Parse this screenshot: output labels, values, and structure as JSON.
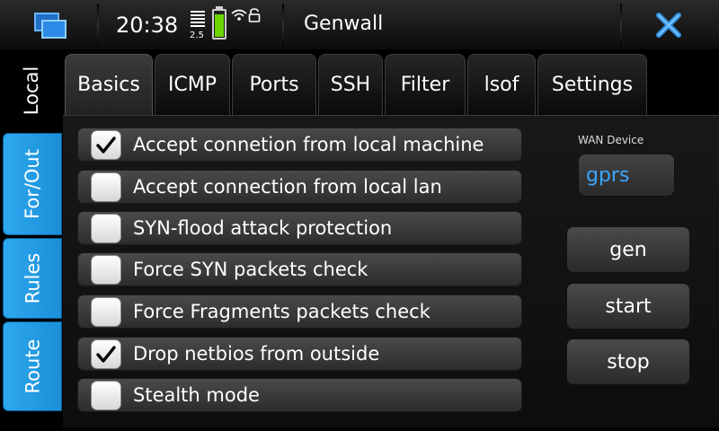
{
  "status_bar": {
    "time": "20:38",
    "network_label": "2.5",
    "battery_level": 0.85,
    "app_title": "Genwall"
  },
  "side_tabs": [
    {
      "label": "Local",
      "active": true
    },
    {
      "label": "For/Out",
      "active": false
    },
    {
      "label": "Rules",
      "active": false
    },
    {
      "label": "Route",
      "active": false
    }
  ],
  "tabs": [
    {
      "label": "Basics",
      "active": true
    },
    {
      "label": "ICMP",
      "active": false
    },
    {
      "label": "Ports",
      "active": false
    },
    {
      "label": "SSH",
      "active": false
    },
    {
      "label": "Filter",
      "active": false
    },
    {
      "label": "lsof",
      "active": false
    },
    {
      "label": "Settings",
      "active": false
    }
  ],
  "options": [
    {
      "label": "Accept connetion from local machine",
      "checked": true
    },
    {
      "label": "Accept connection from local lan",
      "checked": false
    },
    {
      "label": "SYN-flood attack protection",
      "checked": false
    },
    {
      "label": "Force SYN packets check",
      "checked": false
    },
    {
      "label": "Force Fragments packets check",
      "checked": false
    },
    {
      "label": "Drop netbios from outside",
      "checked": true
    },
    {
      "label": "Stealth mode",
      "checked": false
    }
  ],
  "wan": {
    "title": "WAN Device",
    "value": "gprs"
  },
  "actions": {
    "gen": "gen",
    "start": "start",
    "stop": "stop"
  },
  "colors": {
    "side_tab_blue": "#1b8fd8",
    "wan_value": "#3aa6ff",
    "battery_green": "#6cd400",
    "close_icon": "#2f8fe0"
  }
}
